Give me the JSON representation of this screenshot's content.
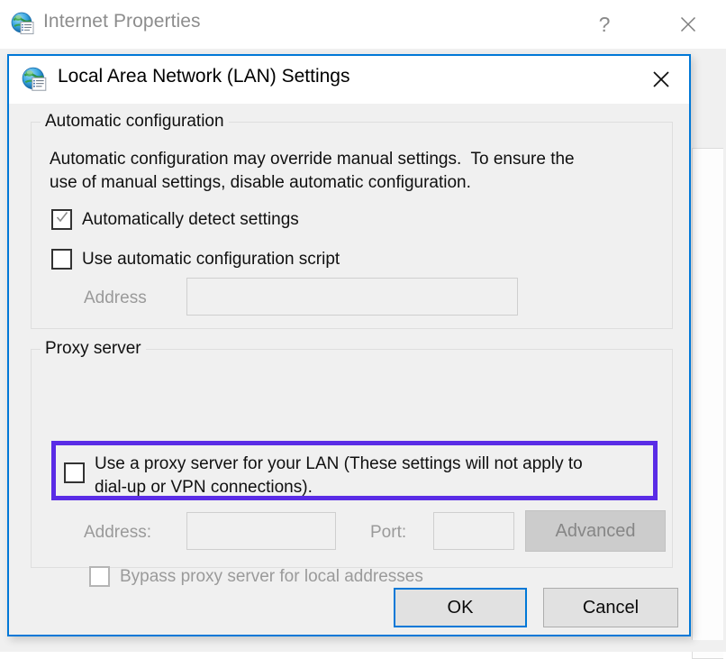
{
  "background_window": {
    "title": "Internet Properties",
    "icon": "internet-properties-globe-icon",
    "help_label": "?",
    "close_label": "✕"
  },
  "dialog": {
    "title": "Local Area Network (LAN) Settings",
    "icon": "internet-properties-globe-icon",
    "close_label": "✕",
    "automatic_configuration": {
      "legend": "Automatic configuration",
      "description_line1": "Automatic configuration may override manual settings.  To ensure the",
      "description_line2": "use of manual settings, disable automatic configuration.",
      "auto_detect": {
        "label": "Automatically detect settings",
        "checked": true,
        "enabled": true
      },
      "use_script": {
        "label": "Use automatic configuration script",
        "checked": false,
        "enabled": true
      },
      "address_label": "Address",
      "address_value": "",
      "address_enabled": false
    },
    "proxy_server": {
      "legend": "Proxy server",
      "use_proxy": {
        "label": "Use a proxy server for your LAN (These settings will not apply to\ndial-up or VPN connections).",
        "checked": false,
        "enabled": true
      },
      "address_label": "Address:",
      "address_value": "",
      "port_label": "Port:",
      "port_value": "",
      "advanced_label": "Advanced",
      "advanced_enabled": false,
      "bypass": {
        "label": "Bypass proxy server for local addresses",
        "checked": false,
        "enabled": false
      }
    },
    "footer": {
      "ok_label": "OK",
      "cancel_label": "Cancel"
    }
  },
  "annotation": {
    "highlight_color": "#5a2ce6",
    "highlight_target": "use-proxy-server-checkbox-row"
  },
  "colors": {
    "accent_blue": "#0078d7",
    "dialog_background": "#f0f0f0",
    "titlebar_background": "#ffffff",
    "disabled_text": "#9a9a9a",
    "body_text": "#101010"
  }
}
